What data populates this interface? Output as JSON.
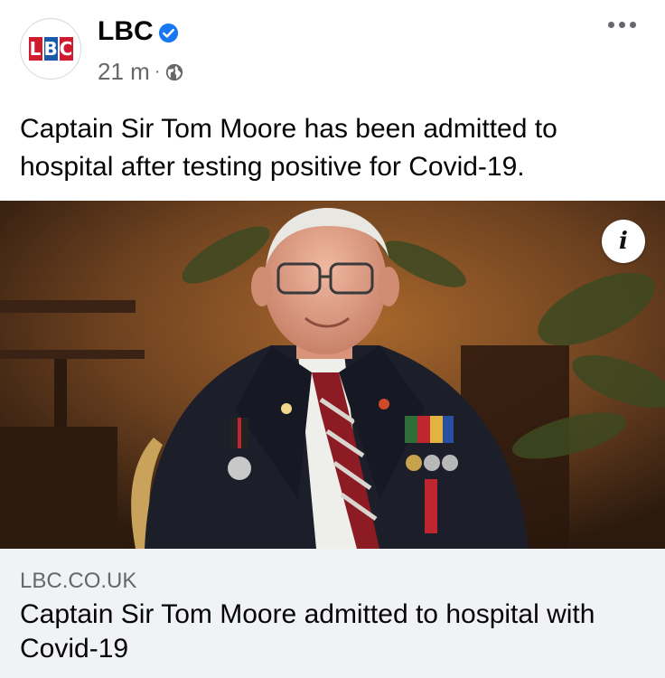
{
  "post": {
    "page_name": "LBC",
    "logo_letters": [
      "L",
      "B",
      "C"
    ],
    "colors": {
      "logo_l": "#d01b2f",
      "logo_b": "#1a5aa8",
      "logo_c": "#d01b2f",
      "verified": "#1877f2"
    },
    "time": "21 m",
    "separator": "·",
    "audience_icon": "globe-icon",
    "text": "Captain Sir Tom Moore has been admitted to hospital after testing positive for Covid-19."
  },
  "photo": {
    "info_label": "i"
  },
  "link": {
    "domain": "LBC.CO.UK",
    "title": "Captain Sir Tom Moore admitted to hospital with Covid-19"
  }
}
